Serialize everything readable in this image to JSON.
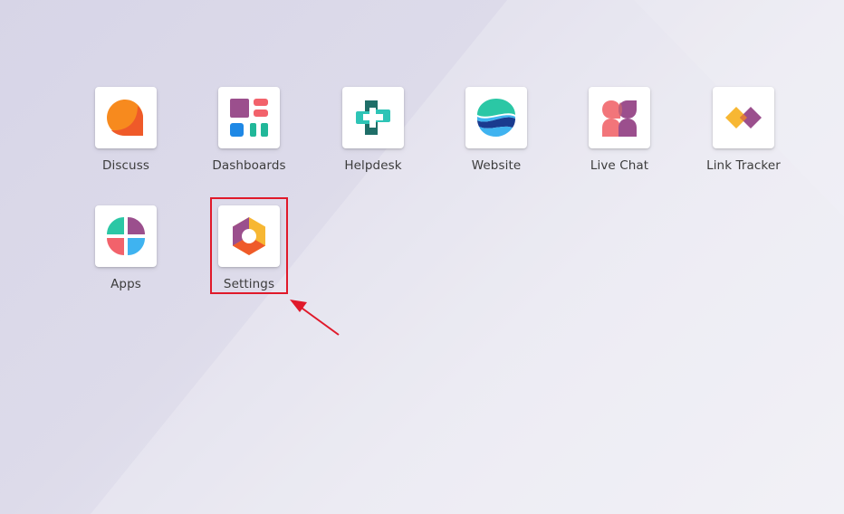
{
  "apps": [
    {
      "label": "Discuss"
    },
    {
      "label": "Dashboards"
    },
    {
      "label": "Helpdesk"
    },
    {
      "label": "Website"
    },
    {
      "label": "Live Chat"
    },
    {
      "label": "Link Tracker"
    },
    {
      "label": "Apps"
    },
    {
      "label": "Settings"
    }
  ],
  "icons": {
    "discuss": "discuss-icon",
    "dashboards": "dashboards-icon",
    "helpdesk": "helpdesk-icon",
    "website": "website-icon",
    "livechat": "live-chat-icon",
    "linktracker": "link-tracker-icon",
    "apps": "apps-icon",
    "settings": "settings-icon"
  },
  "annotation": {
    "highlight_color": "#e0192a"
  }
}
